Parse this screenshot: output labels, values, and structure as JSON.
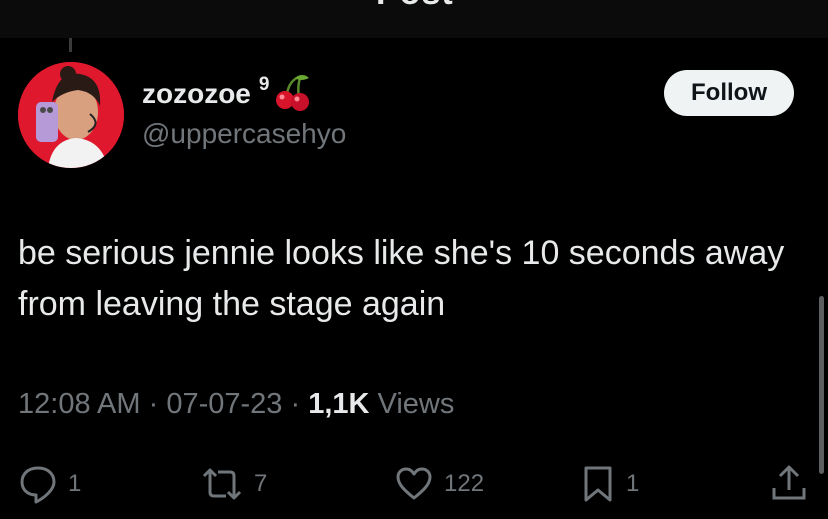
{
  "header": {
    "title": "Post"
  },
  "author": {
    "display_name": "zozozoe",
    "badge_number": "9",
    "emoji": "cherry-icon",
    "handle": "@uppercasehyo"
  },
  "follow_button": {
    "label": "Follow"
  },
  "post": {
    "text": "be serious jennie looks like she's 10 seconds away from leaving the stage again"
  },
  "meta": {
    "time": "12:08 AM",
    "sep1": "·",
    "date": "07-07-23",
    "sep2": "·",
    "views_count": "1,1K",
    "views_label": "Views"
  },
  "actions": {
    "replies": "1",
    "reposts": "7",
    "likes": "122",
    "bookmarks": "1"
  },
  "colors": {
    "background": "#000000",
    "text": "#e7e9ea",
    "muted": "#71767b",
    "follow_bg": "#eff3f4",
    "avatar_bg": "#e0182d"
  }
}
